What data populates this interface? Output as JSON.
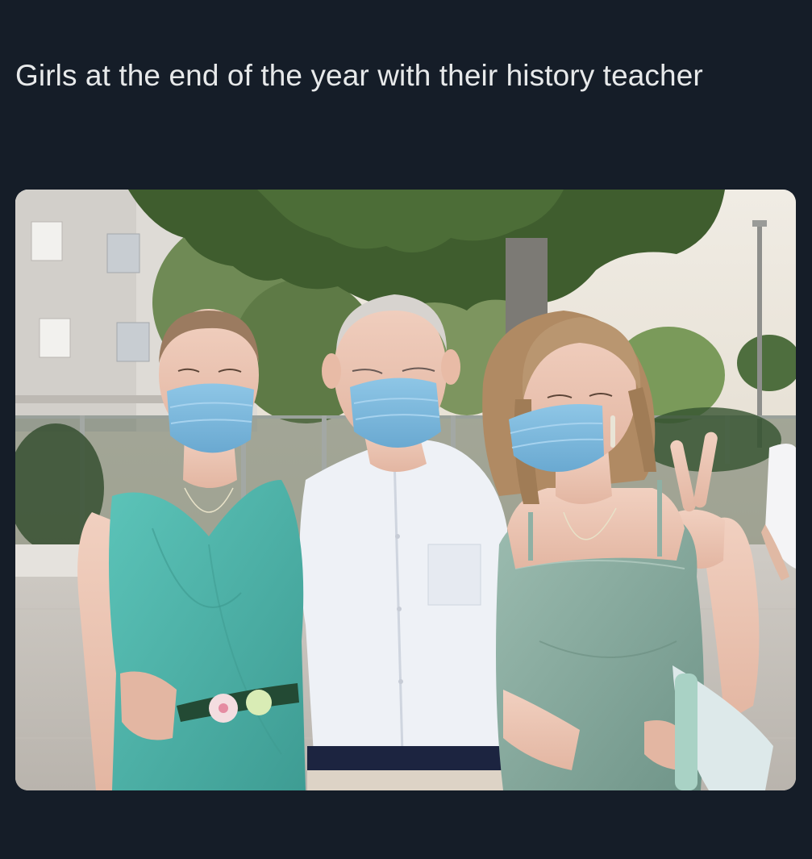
{
  "tweet": {
    "text": "Girls at the end of the year with their history teacher"
  },
  "media": {
    "description_icon": "photo-icon",
    "colors": {
      "background": "#151d28",
      "text": "#e7e9ea",
      "sky": "#e9e6df",
      "building": "#dcdad6",
      "foliage": "#3d5a2c",
      "teal_dress": "#4fb7ad",
      "sage_dress": "#86a99d",
      "shirt": "#eef1f6",
      "mask": "#7fb9dd"
    }
  }
}
